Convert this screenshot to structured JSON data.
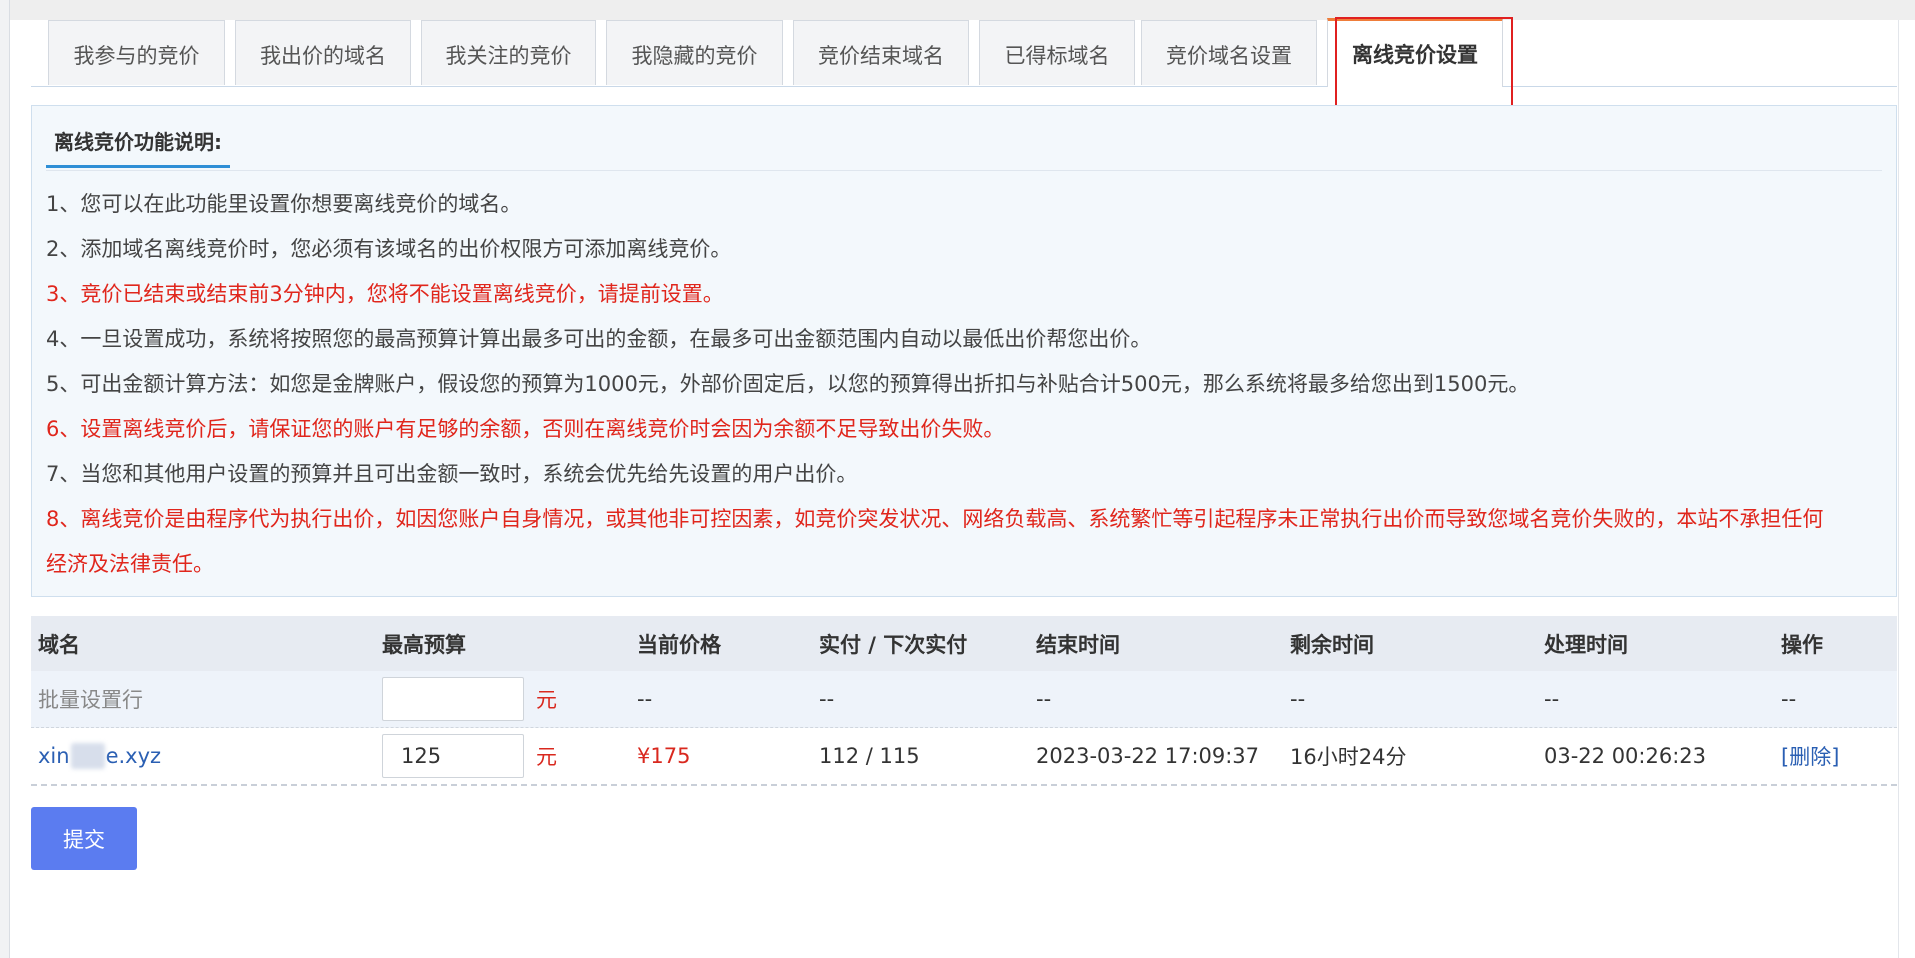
{
  "tabs": [
    {
      "label": "我参与的竞价",
      "active": false
    },
    {
      "label": "我出价的域名",
      "active": false
    },
    {
      "label": "我关注的竞价",
      "active": false
    },
    {
      "label": "我隐藏的竞价",
      "active": false
    },
    {
      "label": "竞价结束域名",
      "active": false
    },
    {
      "label": "已得标域名",
      "active": false
    },
    {
      "label": "竞价域名设置",
      "active": false
    },
    {
      "label": "离线竞价设置",
      "active": true
    }
  ],
  "info": {
    "title": "离线竞价功能说明:",
    "lines": [
      {
        "text": "1、您可以在此功能里设置你想要离线竞价的域名。",
        "highlight": false
      },
      {
        "text": "2、添加域名离线竞价时，您必须有该域名的出价权限方可添加离线竞价。",
        "highlight": false
      },
      {
        "text": "3、竞价已结束或结束前3分钟内，您将不能设置离线竞价，请提前设置。",
        "highlight": true
      },
      {
        "text": "4、一旦设置成功，系统将按照您的最高预算计算出最多可出的金额，在最多可出金额范围内自动以最低出价帮您出价。",
        "highlight": false
      },
      {
        "text": "5、可出金额计算方法：如您是金牌账户，假设您的预算为1000元，外部价固定后，以您的预算得出折扣与补贴合计500元，那么系统将最多给您出到1500元。",
        "highlight": false
      },
      {
        "text": "6、设置离线竞价后，请保证您的账户有足够的余额，否则在离线竞价时会因为余额不足导致出价失败。",
        "highlight": true
      },
      {
        "text": "7、当您和其他用户设置的预算并且可出金额一致时，系统会优先给先设置的用户出价。",
        "highlight": false
      },
      {
        "text": "8、离线竞价是由程序代为执行出价，如因您账户自身情况，或其他非可控因素，如竞价突发状况、网络负载高、系统繁忙等引起程序未正常执行出价而导致您域名竞价失败的，本站不承担任何",
        "highlight": true
      },
      {
        "text": "经济及法律责任。",
        "highlight": true
      }
    ]
  },
  "table": {
    "headers": {
      "domain": "域名",
      "budget": "最高预算",
      "price": "当前价格",
      "paid": "实付 / 下次实付",
      "end_time": "结束时间",
      "remaining": "剩余时间",
      "process_time": "处理时间",
      "action": "操作"
    },
    "batch_row": {
      "label": "批量设置行",
      "budget_value": "",
      "unit": "元",
      "price": "--",
      "paid": "--",
      "end_time": "--",
      "remaining": "--",
      "process_time": "--",
      "action": "--"
    },
    "rows": [
      {
        "domain_prefix": "xin",
        "domain_suffix": "e.xyz",
        "budget_value": "125",
        "unit": "元",
        "price": "¥175",
        "paid": "112 / 115",
        "end_time": "2023-03-22 17:09:37",
        "remaining": "16小时24分",
        "process_time": "03-22 00:26:23",
        "action": "[删除]"
      }
    ]
  },
  "submit_label": "提交",
  "colors": {
    "accent_red": "#e0261c",
    "link_blue": "#2a5fb3",
    "button_blue": "#5b7cf0",
    "tab_active_top": "#ef7d3a"
  }
}
